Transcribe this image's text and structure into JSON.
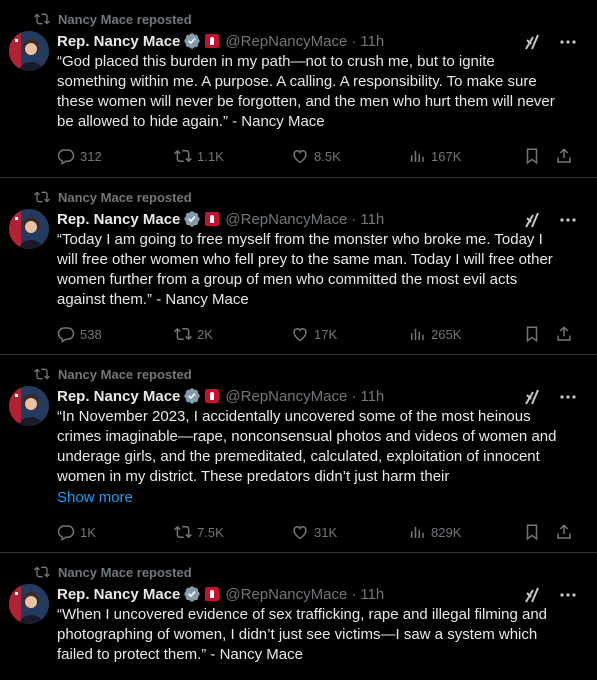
{
  "tweets": [
    {
      "repost_label": "Nancy Mace reposted",
      "name": "Rep. Nancy Mace",
      "handle": "@RepNancyMace",
      "time": "11h",
      "text": "“God placed this burden in my path—not to crush me, but to ignite\nsomething within me. A purpose. A calling. A responsibility. To make sure\nthese women will never be forgotten, and the men who hurt them will never\nbe allowed to hide again.” - Nancy Mace",
      "replies": "312",
      "reposts": "1.1K",
      "likes": "8.5K",
      "views": "167K"
    },
    {
      "repost_label": "Nancy Mace reposted",
      "name": "Rep. Nancy Mace",
      "handle": "@RepNancyMace",
      "time": "11h",
      "text": "“Today I am going to free myself from the monster who broke me. Today I\nwill free other women who fell prey to the same man. Today I will free other\nwomen further from a group of men who committed the most evil acts\nagainst them.” - Nancy Mace",
      "replies": "538",
      "reposts": "2K",
      "likes": "17K",
      "views": "265K"
    },
    {
      "repost_label": "Nancy Mace reposted",
      "name": "Rep. Nancy Mace",
      "handle": "@RepNancyMace",
      "time": "11h",
      "text": "“In November 2023, I accidentally uncovered some of the most heinous\ncrimes imaginable—rape, nonconsensual photos and videos of women and\nunderage girls, and the premeditated, calculated, exploitation of innocent\nwomen in my district. These predators didn’t just harm their",
      "show_more": "Show more",
      "replies": "1K",
      "reposts": "7.5K",
      "likes": "31K",
      "views": "829K"
    },
    {
      "repost_label": "Nancy Mace reposted",
      "name": "Rep. Nancy Mace",
      "handle": "@RepNancyMace",
      "time": "11h",
      "text": "“When I uncovered evidence of sex trafficking, rape and illegal filming and\nphotographing of women, I didn’t just see victims—I saw a system which\nfailed to protect them.” - Nancy Mace"
    }
  ],
  "colors": {
    "background": "#000000",
    "text": "#e7e9ea",
    "muted": "#71767b",
    "link": "#1d9bf0",
    "verified_gray": "#829aab",
    "divider": "#2f3336"
  }
}
